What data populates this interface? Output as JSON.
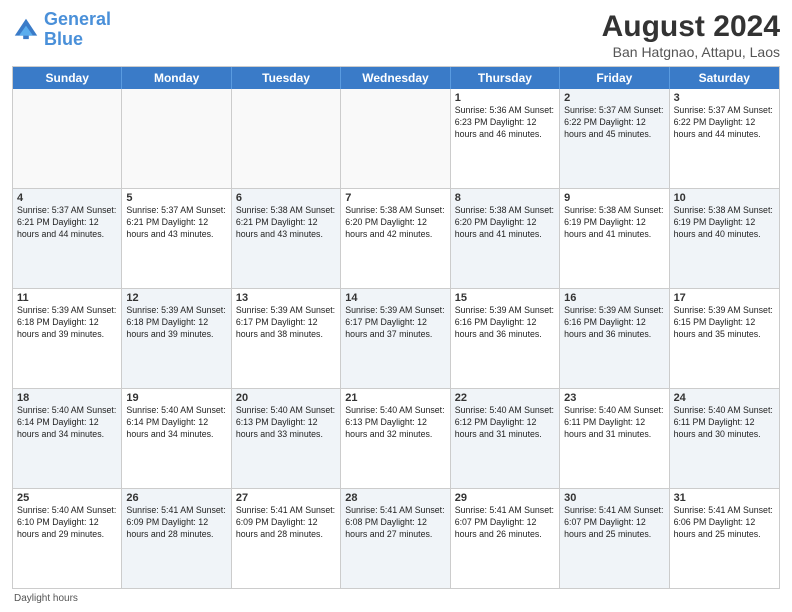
{
  "header": {
    "logo_text_general": "General",
    "logo_text_blue": "Blue",
    "month_title": "August 2024",
    "location": "Ban Hatgnao, Attapu, Laos"
  },
  "day_headers": [
    "Sunday",
    "Monday",
    "Tuesday",
    "Wednesday",
    "Thursday",
    "Friday",
    "Saturday"
  ],
  "footer": {
    "note": "Daylight hours"
  },
  "weeks": [
    [
      {
        "day": "",
        "info": "",
        "empty": true
      },
      {
        "day": "",
        "info": "",
        "empty": true
      },
      {
        "day": "",
        "info": "",
        "empty": true
      },
      {
        "day": "",
        "info": "",
        "empty": true
      },
      {
        "day": "1",
        "info": "Sunrise: 5:36 AM\nSunset: 6:23 PM\nDaylight: 12 hours\nand 46 minutes.",
        "shaded": false
      },
      {
        "day": "2",
        "info": "Sunrise: 5:37 AM\nSunset: 6:22 PM\nDaylight: 12 hours\nand 45 minutes.",
        "shaded": true
      },
      {
        "day": "3",
        "info": "Sunrise: 5:37 AM\nSunset: 6:22 PM\nDaylight: 12 hours\nand 44 minutes.",
        "shaded": false
      }
    ],
    [
      {
        "day": "4",
        "info": "Sunrise: 5:37 AM\nSunset: 6:21 PM\nDaylight: 12 hours\nand 44 minutes.",
        "shaded": true
      },
      {
        "day": "5",
        "info": "Sunrise: 5:37 AM\nSunset: 6:21 PM\nDaylight: 12 hours\nand 43 minutes.",
        "shaded": false
      },
      {
        "day": "6",
        "info": "Sunrise: 5:38 AM\nSunset: 6:21 PM\nDaylight: 12 hours\nand 43 minutes.",
        "shaded": true
      },
      {
        "day": "7",
        "info": "Sunrise: 5:38 AM\nSunset: 6:20 PM\nDaylight: 12 hours\nand 42 minutes.",
        "shaded": false
      },
      {
        "day": "8",
        "info": "Sunrise: 5:38 AM\nSunset: 6:20 PM\nDaylight: 12 hours\nand 41 minutes.",
        "shaded": true
      },
      {
        "day": "9",
        "info": "Sunrise: 5:38 AM\nSunset: 6:19 PM\nDaylight: 12 hours\nand 41 minutes.",
        "shaded": false
      },
      {
        "day": "10",
        "info": "Sunrise: 5:38 AM\nSunset: 6:19 PM\nDaylight: 12 hours\nand 40 minutes.",
        "shaded": true
      }
    ],
    [
      {
        "day": "11",
        "info": "Sunrise: 5:39 AM\nSunset: 6:18 PM\nDaylight: 12 hours\nand 39 minutes.",
        "shaded": false
      },
      {
        "day": "12",
        "info": "Sunrise: 5:39 AM\nSunset: 6:18 PM\nDaylight: 12 hours\nand 39 minutes.",
        "shaded": true
      },
      {
        "day": "13",
        "info": "Sunrise: 5:39 AM\nSunset: 6:17 PM\nDaylight: 12 hours\nand 38 minutes.",
        "shaded": false
      },
      {
        "day": "14",
        "info": "Sunrise: 5:39 AM\nSunset: 6:17 PM\nDaylight: 12 hours\nand 37 minutes.",
        "shaded": true
      },
      {
        "day": "15",
        "info": "Sunrise: 5:39 AM\nSunset: 6:16 PM\nDaylight: 12 hours\nand 36 minutes.",
        "shaded": false
      },
      {
        "day": "16",
        "info": "Sunrise: 5:39 AM\nSunset: 6:16 PM\nDaylight: 12 hours\nand 36 minutes.",
        "shaded": true
      },
      {
        "day": "17",
        "info": "Sunrise: 5:39 AM\nSunset: 6:15 PM\nDaylight: 12 hours\nand 35 minutes.",
        "shaded": false
      }
    ],
    [
      {
        "day": "18",
        "info": "Sunrise: 5:40 AM\nSunset: 6:14 PM\nDaylight: 12 hours\nand 34 minutes.",
        "shaded": true
      },
      {
        "day": "19",
        "info": "Sunrise: 5:40 AM\nSunset: 6:14 PM\nDaylight: 12 hours\nand 34 minutes.",
        "shaded": false
      },
      {
        "day": "20",
        "info": "Sunrise: 5:40 AM\nSunset: 6:13 PM\nDaylight: 12 hours\nand 33 minutes.",
        "shaded": true
      },
      {
        "day": "21",
        "info": "Sunrise: 5:40 AM\nSunset: 6:13 PM\nDaylight: 12 hours\nand 32 minutes.",
        "shaded": false
      },
      {
        "day": "22",
        "info": "Sunrise: 5:40 AM\nSunset: 6:12 PM\nDaylight: 12 hours\nand 31 minutes.",
        "shaded": true
      },
      {
        "day": "23",
        "info": "Sunrise: 5:40 AM\nSunset: 6:11 PM\nDaylight: 12 hours\nand 31 minutes.",
        "shaded": false
      },
      {
        "day": "24",
        "info": "Sunrise: 5:40 AM\nSunset: 6:11 PM\nDaylight: 12 hours\nand 30 minutes.",
        "shaded": true
      }
    ],
    [
      {
        "day": "25",
        "info": "Sunrise: 5:40 AM\nSunset: 6:10 PM\nDaylight: 12 hours\nand 29 minutes.",
        "shaded": false
      },
      {
        "day": "26",
        "info": "Sunrise: 5:41 AM\nSunset: 6:09 PM\nDaylight: 12 hours\nand 28 minutes.",
        "shaded": true
      },
      {
        "day": "27",
        "info": "Sunrise: 5:41 AM\nSunset: 6:09 PM\nDaylight: 12 hours\nand 28 minutes.",
        "shaded": false
      },
      {
        "day": "28",
        "info": "Sunrise: 5:41 AM\nSunset: 6:08 PM\nDaylight: 12 hours\nand 27 minutes.",
        "shaded": true
      },
      {
        "day": "29",
        "info": "Sunrise: 5:41 AM\nSunset: 6:07 PM\nDaylight: 12 hours\nand 26 minutes.",
        "shaded": false
      },
      {
        "day": "30",
        "info": "Sunrise: 5:41 AM\nSunset: 6:07 PM\nDaylight: 12 hours\nand 25 minutes.",
        "shaded": true
      },
      {
        "day": "31",
        "info": "Sunrise: 5:41 AM\nSunset: 6:06 PM\nDaylight: 12 hours\nand 25 minutes.",
        "shaded": false
      }
    ]
  ]
}
